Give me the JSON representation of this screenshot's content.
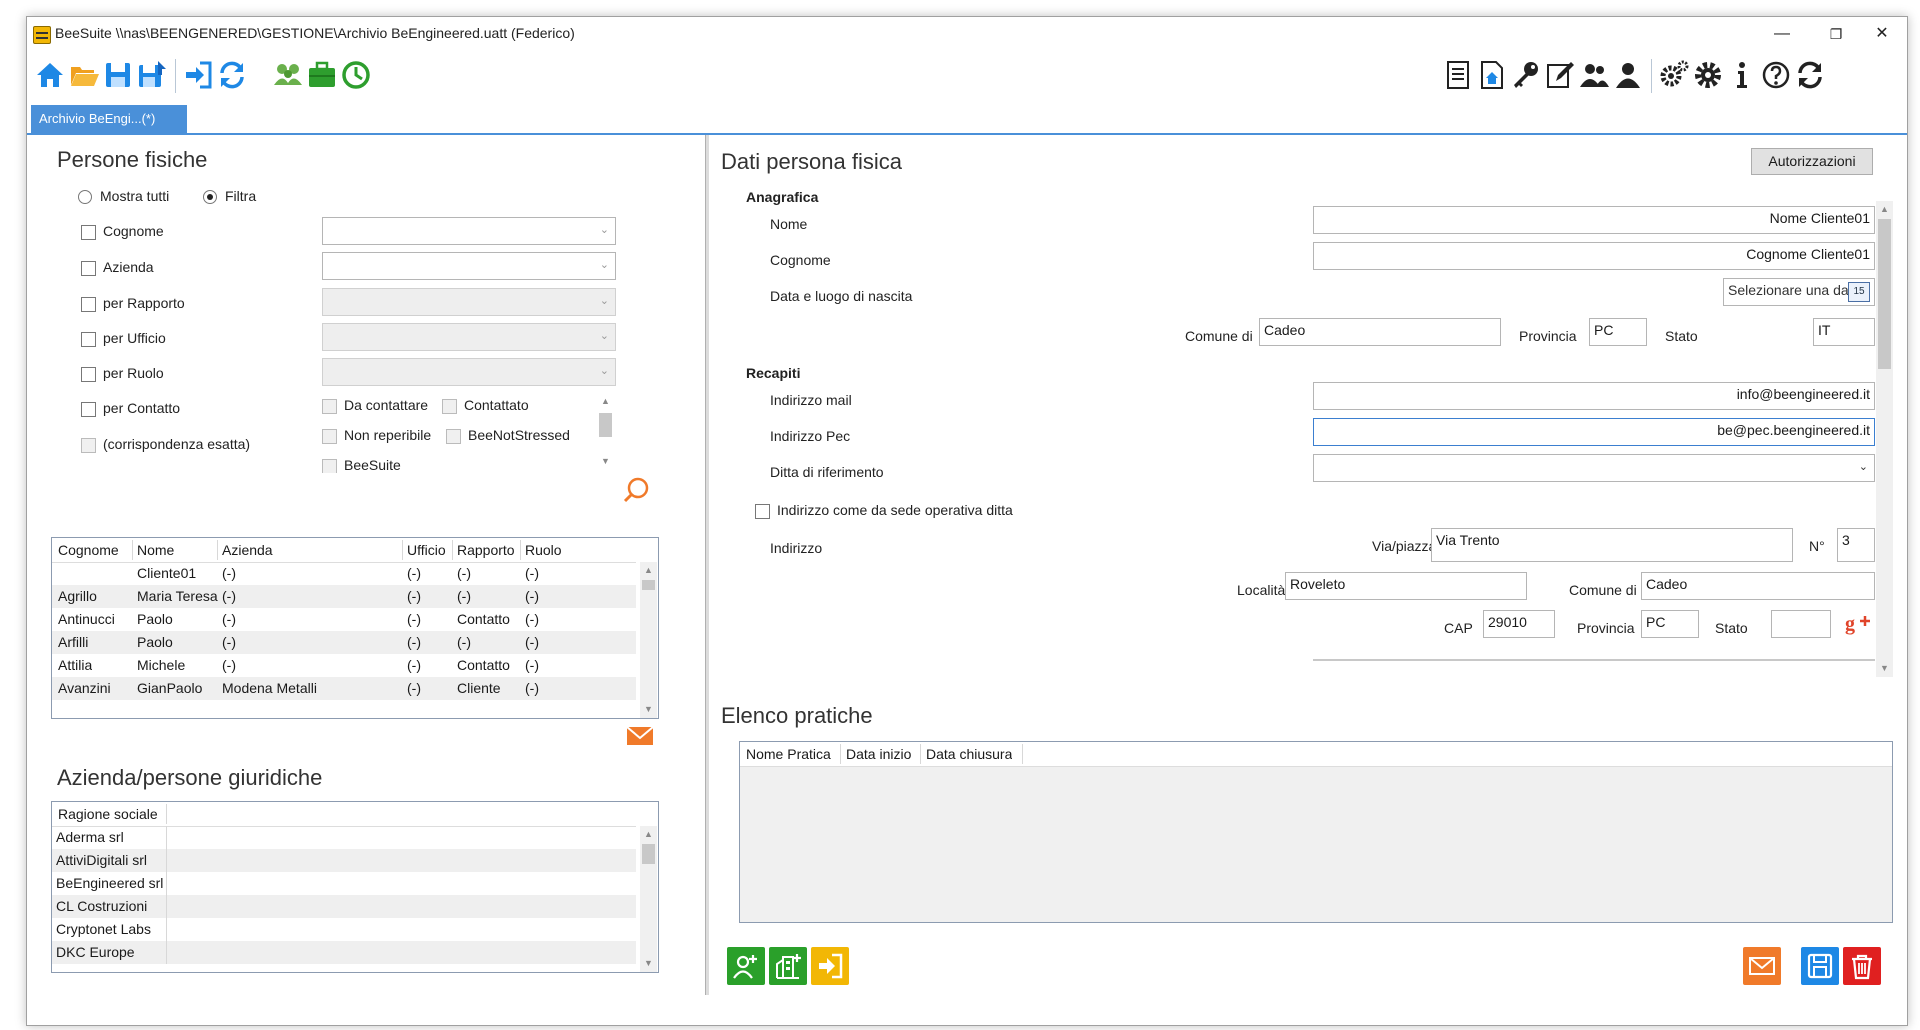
{
  "window": {
    "title": "BeeSuite \\\\nas\\BEENGENERED\\GESTIONE\\Archivio BeEngineered.uatt (Federico)",
    "minimize": "—",
    "maximize": "❐",
    "close": "✕"
  },
  "tab": {
    "label": "Archivio BeEngi...(*)"
  },
  "colors": {
    "accent": "#4a90d9",
    "green": "#2aa02a",
    "orange": "#f07a2a",
    "red": "#e02020",
    "toolbar_blue": "#1e88e5"
  },
  "toolbar_left": [
    "home-icon",
    "folder-open-icon",
    "save-icon",
    "save-as-icon",
    "login-icon",
    "refresh-icon",
    "users-group-icon",
    "briefcase-icon",
    "clock-icon"
  ],
  "toolbar_right": [
    "document-icon",
    "document-home-icon",
    "key-icon",
    "edit-icon",
    "users-icon",
    "user-icon",
    "settings-multi-icon",
    "gear-icon",
    "info-icon",
    "help-icon",
    "sync-icon"
  ],
  "persone": {
    "title": "Persone fisiche",
    "mostra_tutti": "Mostra tutti",
    "filtra": "Filtra",
    "filters": [
      "Cognome",
      "Azienda",
      "per Rapporto",
      "per Ufficio",
      "per Ruolo",
      "per Contatto",
      "(corrispondenza esatta)"
    ],
    "contact_opts": [
      "Da contattare",
      "Contattato",
      "Non reperibile",
      "BeeNotStressed",
      "BeeSuite"
    ],
    "columns": [
      "Cognome",
      "Nome",
      "Azienda",
      "Ufficio",
      "Rapporto",
      "Ruolo"
    ],
    "rows": [
      [
        "",
        "Cliente01",
        "(-)",
        "(-)",
        "(-)",
        "(-)"
      ],
      [
        "Agrillo",
        "Maria Teresa",
        "(-)",
        "(-)",
        "(-)",
        "(-)"
      ],
      [
        "Antinucci",
        "Paolo",
        "(-)",
        "(-)",
        "Contatto",
        "(-)"
      ],
      [
        "Arfilli",
        "Paolo",
        "(-)",
        "(-)",
        "(-)",
        "(-)"
      ],
      [
        "Attilia",
        "Michele",
        "(-)",
        "(-)",
        "Contatto",
        "(-)"
      ],
      [
        "Avanzini",
        "GianPaolo",
        "Modena Metalli",
        "(-)",
        "Cliente",
        "(-)"
      ]
    ]
  },
  "aziende": {
    "title": "Azienda/persone giuridiche",
    "column": "Ragione sociale",
    "rows": [
      "Aderma srl",
      "AttiviDigitali srl",
      "BeEngineered srl",
      "CL Costruzioni",
      "Cryptonet Labs",
      "DKC Europe"
    ]
  },
  "dati": {
    "title": "Dati persona fisica",
    "autorizzazioni": "Autorizzazioni",
    "anagrafica": "Anagrafica",
    "nome_label": "Nome",
    "nome": "Nome Cliente01",
    "cognome_label": "Cognome",
    "cognome": "Cognome Cliente01",
    "nascita_label": "Data e luogo di nascita",
    "data_placeholder": "Selezionare una data",
    "calendar_day": "15",
    "comune_di_label": "Comune di",
    "comune_nascita": "Cadeo",
    "provincia_label": "Provincia",
    "provincia_nascita": "PC",
    "stato_label": "Stato",
    "stato_nascita": "IT",
    "recapiti": "Recapiti",
    "mail_label": "Indirizzo mail",
    "mail": "info@beengineered.it",
    "pec_label": "Indirizzo Pec",
    "pec": "be@pec.beengineered.it",
    "ditta_label": "Ditta di riferimento",
    "sede_label": "Indirizzo come da sede operativa ditta",
    "indirizzo_label": "Indirizzo",
    "via_label": "Via/piazza",
    "via": "Via Trento",
    "num_label": "N°",
    "num": "3",
    "localita_label": "Località",
    "localita": "Roveleto",
    "comune": "Cadeo",
    "cap_label": "CAP",
    "cap": "29010",
    "provincia": "PC",
    "stato": ""
  },
  "pratiche": {
    "title": "Elenco pratiche",
    "columns": [
      "Nome Pratica",
      "Data inizio",
      "Data chiusura"
    ]
  }
}
